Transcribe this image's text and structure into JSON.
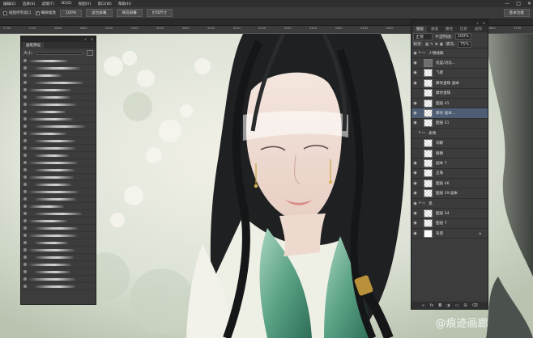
{
  "menubar": {
    "items": [
      "编辑(E)",
      "选择(S)",
      "滤镜(T)",
      "3D(D)",
      "视图(V)",
      "窗口(W)",
      "帮助(H)"
    ],
    "controls": [
      "—",
      "□",
      "✕"
    ]
  },
  "options_bar": {
    "check1_label": "缩放所有窗口",
    "check2_label": "细微缩放",
    "buttons": [
      "100%",
      "适合屏幕",
      "填充屏幕",
      "打印尺寸"
    ],
    "workspace": "基本功能"
  },
  "ruler_ticks": [
    "2700",
    "2750",
    "2800",
    "2850",
    "2900",
    "2950",
    "3000",
    "3050",
    "3100",
    "3150",
    "3200",
    "3250",
    "3300",
    "3350",
    "3400",
    "3450",
    "3500",
    "3550",
    "3600",
    "3650",
    "3700"
  ],
  "brush_panel": {
    "title": "画笔预设",
    "size_label": "大小:",
    "controls": [
      "«",
      "×"
    ]
  },
  "layers_panel": {
    "tabs": [
      "图层",
      "通道",
      "路径",
      "历史",
      "动作"
    ],
    "blend_mode": "正常",
    "opacity_label": "不透明度:",
    "opacity_value": "100%",
    "lock_label": "锁定:",
    "fill_label": "填充:",
    "fill_value": "75%",
    "controls": [
      "«",
      "×"
    ],
    "layers": [
      {
        "name": "人物线稿",
        "group": true,
        "visible": true
      },
      {
        "name": "亮度/对比...",
        "adjust": true,
        "visible": true
      },
      {
        "name": "飞絮",
        "visible": true
      },
      {
        "name": "摩纹金珠 副本",
        "visible": true
      },
      {
        "name": "摩纹金珠",
        "visible": false
      },
      {
        "name": "图层 41",
        "visible": true
      },
      {
        "name": "摩纹 副本...",
        "visible": true,
        "selected": true
      },
      {
        "name": "图层 21",
        "visible": true
      },
      {
        "name": "表情",
        "group": true,
        "visible": false
      },
      {
        "name": "词眼",
        "visible": false
      },
      {
        "name": "眼睛",
        "visible": false
      },
      {
        "name": "副本 7",
        "visible": true
      },
      {
        "name": "五珠",
        "visible": true
      },
      {
        "name": "图层 46",
        "visible": true
      },
      {
        "name": "图层 29 副本",
        "visible": true
      },
      {
        "name": "黑",
        "group": true,
        "visible": true
      },
      {
        "name": "图层 34",
        "visible": true
      },
      {
        "name": "图层 7",
        "visible": true
      },
      {
        "name": "背景",
        "visible": true,
        "locked": true,
        "white": true
      }
    ],
    "footer_icons": [
      "link-icon",
      "fx-icon",
      "mask-icon",
      "adjust-icon",
      "folder-icon",
      "new-layer-icon",
      "trash-icon"
    ]
  },
  "watermark": "@痕迹画廊"
}
